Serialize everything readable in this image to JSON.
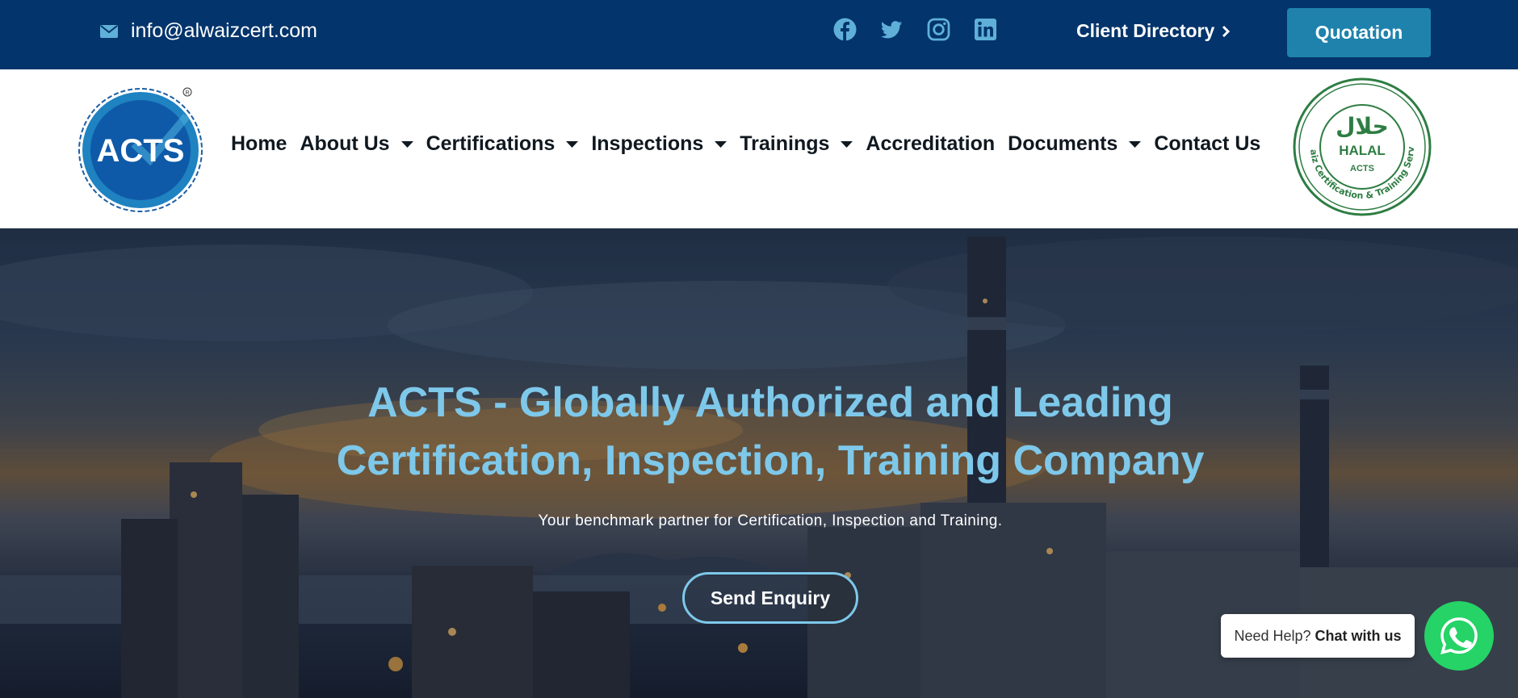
{
  "topbar": {
    "email": "info@alwaizcert.com",
    "email_icon": "envelope-icon",
    "socials": [
      "facebook-icon",
      "twitter-icon",
      "instagram-icon",
      "linkedin-icon"
    ],
    "client_directory": "Client Directory",
    "quotation": "Quotation",
    "bg_color": "#03346b",
    "accent_color": "#1f82ad"
  },
  "header": {
    "logo_text": "ACTS",
    "nav": [
      {
        "label": "Home",
        "dropdown": false
      },
      {
        "label": "About Us",
        "dropdown": true
      },
      {
        "label": "Certifications",
        "dropdown": true
      },
      {
        "label": "Inspections",
        "dropdown": true
      },
      {
        "label": "Trainings",
        "dropdown": true
      },
      {
        "label": "Accreditation",
        "dropdown": false
      },
      {
        "label": "Documents",
        "dropdown": true
      },
      {
        "label": "Contact Us",
        "dropdown": false
      }
    ],
    "halal_logo": {
      "arabic": "حلال",
      "word": "HALAL",
      "brand": "ACTS",
      "ring_text": "Al-Waiz Certification & Training Services"
    }
  },
  "hero": {
    "title_line1": "ACTS - Globally Authorized and Leading",
    "title_line2": "Certification, Inspection, Training Company",
    "subtitle": "Your benchmark partner for Certification, Inspection and Training.",
    "cta": "Send Enquiry",
    "title_color": "#7ec8ea"
  },
  "chat": {
    "prefix": "Need Help?",
    "strong": "Chat with us",
    "icon": "whatsapp-icon",
    "color": "#25d366"
  }
}
